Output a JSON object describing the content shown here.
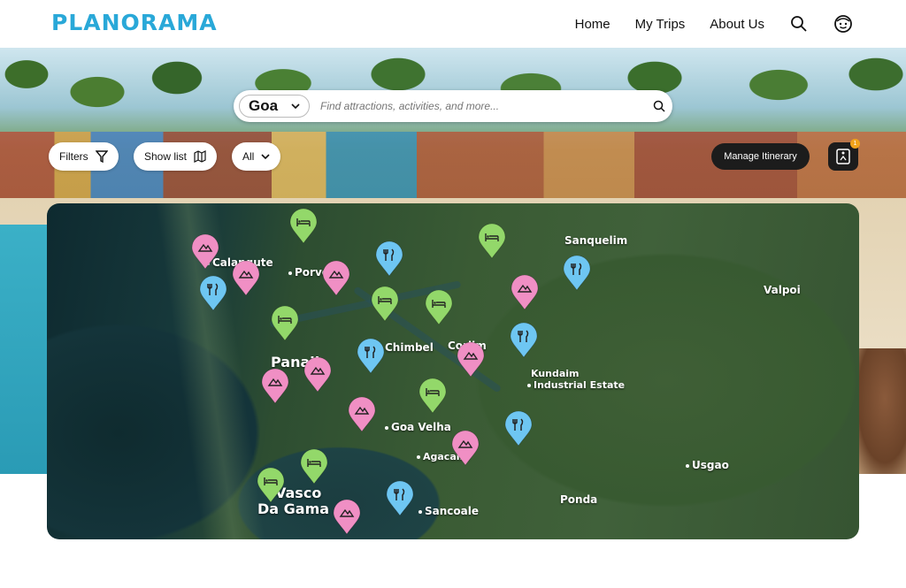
{
  "nav": {
    "logo": "PLANORAMA",
    "links": [
      "Home",
      "My Trips",
      "About Us"
    ],
    "search_icon": "search-icon",
    "profile_icon": "face-icon"
  },
  "search": {
    "location": "Goa",
    "placeholder": "Find attractions, activities, and more..."
  },
  "controls": {
    "filters_label": "Filters",
    "show_list_label": "Show list",
    "all_label": "All",
    "manage_label": "Manage Itinerary",
    "itinerary_badge": "1"
  },
  "colors": {
    "brand": "#29a8d8",
    "attraction_pin": "#f08fc4",
    "food_pin": "#6ec6f2",
    "hotel_pin": "#93d86a",
    "dark_button": "#1c1c1c"
  },
  "map": {
    "places": [
      {
        "name": "Calangute",
        "big": false
      },
      {
        "name": "Porvo",
        "big": false
      },
      {
        "name": "Sanquelim",
        "big": false
      },
      {
        "name": "Valpoi",
        "big": false
      },
      {
        "name": "Chimbel",
        "big": false
      },
      {
        "name": "Corlim",
        "big": false
      },
      {
        "name": "Panaji",
        "big": true
      },
      {
        "name": "Kundaim",
        "big": false
      },
      {
        "name": "Industrial Estate",
        "big": false
      },
      {
        "name": "Goa Velha",
        "big": false
      },
      {
        "name": "Agacaim",
        "big": false
      },
      {
        "name": "Usgao",
        "big": false
      },
      {
        "name": "Vasco",
        "big": true
      },
      {
        "name": "Da Gama",
        "big": true
      },
      {
        "name": "Ponda",
        "big": false
      },
      {
        "name": "Sancoale",
        "big": false
      }
    ],
    "pins": [
      {
        "type": "hotel"
      },
      {
        "type": "attraction"
      },
      {
        "type": "hotel"
      },
      {
        "type": "food"
      },
      {
        "type": "food"
      },
      {
        "type": "attraction"
      },
      {
        "type": "attraction"
      },
      {
        "type": "food"
      },
      {
        "type": "attraction"
      },
      {
        "type": "hotel"
      },
      {
        "type": "hotel"
      },
      {
        "type": "hotel"
      },
      {
        "type": "food"
      },
      {
        "type": "attraction"
      },
      {
        "type": "attraction"
      },
      {
        "type": "attraction"
      },
      {
        "type": "food"
      },
      {
        "type": "attraction"
      },
      {
        "type": "hotel"
      },
      {
        "type": "attraction"
      },
      {
        "type": "food"
      },
      {
        "type": "hotel"
      },
      {
        "type": "hotel"
      },
      {
        "type": "food"
      },
      {
        "type": "attraction"
      }
    ]
  }
}
